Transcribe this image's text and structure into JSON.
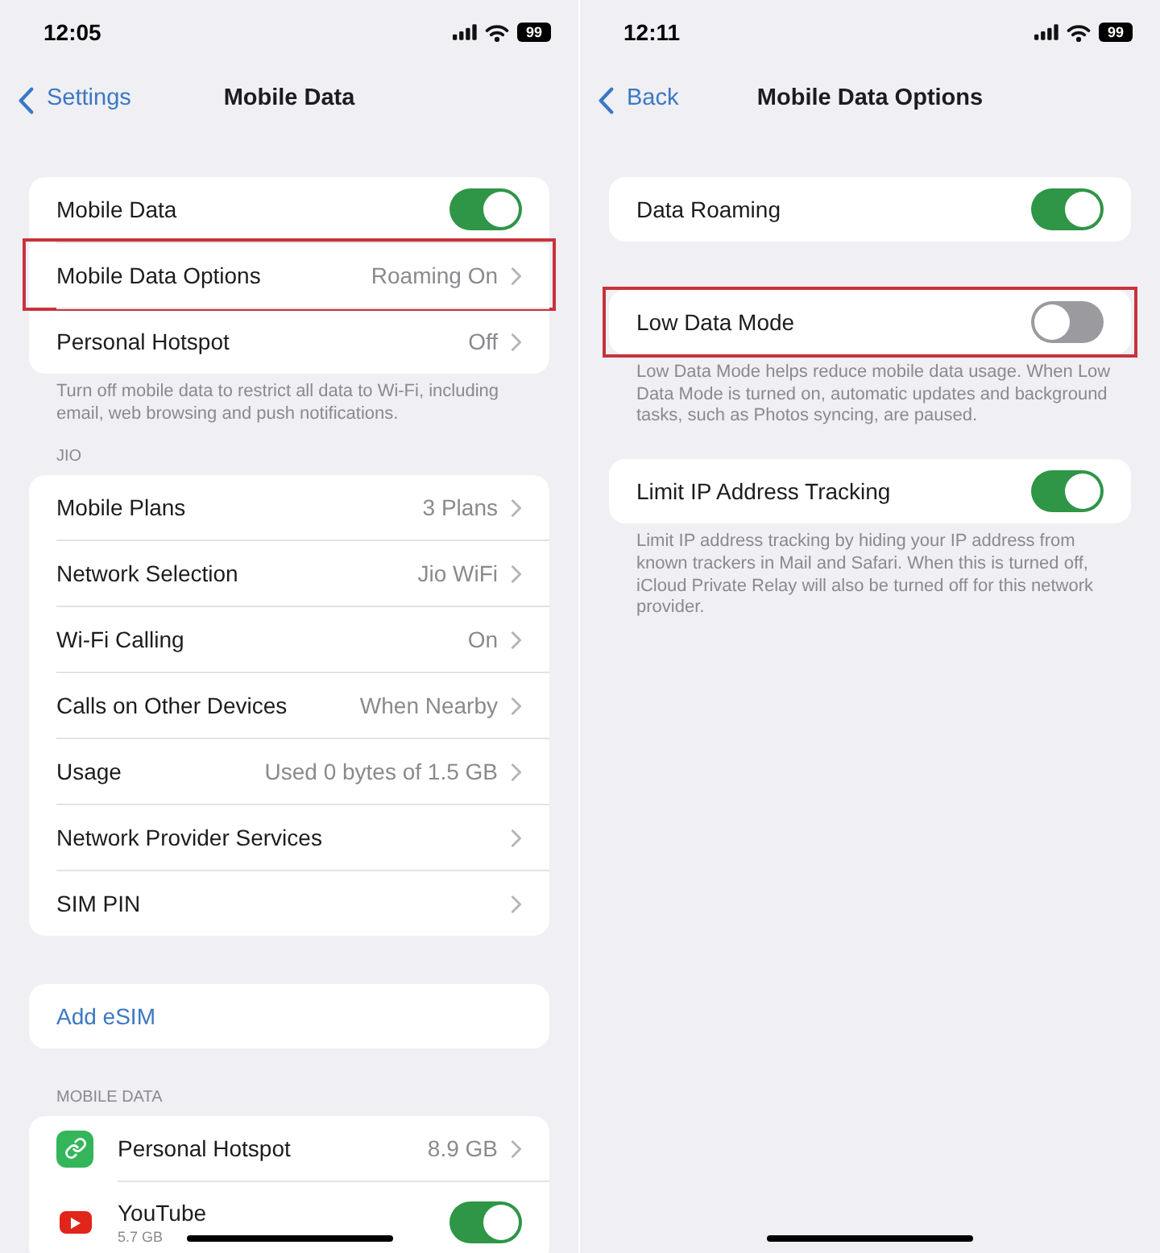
{
  "screens": [
    {
      "status_bar": {
        "time": "12:05",
        "battery": "99"
      },
      "nav": {
        "back": "Settings",
        "title": "Mobile Data"
      },
      "sections": [
        {
          "rows": [
            {
              "kind": "toggle",
              "label": "Mobile Data",
              "on": true,
              "highlighted": false
            },
            {
              "kind": "link",
              "label": "Mobile Data Options",
              "value": "Roaming On",
              "highlighted": true
            },
            {
              "kind": "link",
              "label": "Personal Hotspot",
              "value": "Off",
              "highlighted": false
            }
          ],
          "footer": "Turn off mobile data to restrict all data to Wi-Fi, including email, web browsing and push notifications."
        },
        {
          "header": "JIO",
          "rows": [
            {
              "kind": "link",
              "label": "Mobile Plans",
              "value": "3 Plans",
              "highlighted": false
            },
            {
              "kind": "link",
              "label": "Network Selection",
              "value": "Jio WiFi",
              "highlighted": false
            },
            {
              "kind": "link",
              "label": "Wi-Fi Calling",
              "value": "On",
              "highlighted": false
            },
            {
              "kind": "link",
              "label": "Calls on Other Devices",
              "value": "When Nearby",
              "highlighted": false
            },
            {
              "kind": "link",
              "label": "Usage",
              "value": "Used 0 bytes of 1.5 GB",
              "highlighted": false
            },
            {
              "kind": "link",
              "label": "Network Provider Services",
              "highlighted": false
            },
            {
              "kind": "link",
              "label": "SIM PIN",
              "highlighted": false
            }
          ]
        },
        {
          "rows": [
            {
              "kind": "action",
              "label": "Add eSIM",
              "highlighted": false
            }
          ]
        },
        {
          "header": "MOBILE DATA",
          "rows": [
            {
              "kind": "app_link",
              "label": "Personal Hotspot",
              "value": "8.9 GB",
              "color": "#34b55a",
              "highlighted": false
            },
            {
              "kind": "app_toggle",
              "label": "YouTube",
              "detail": "5.7 GB",
              "on": true,
              "color": "#e1251b",
              "highlighted": false
            }
          ]
        }
      ]
    },
    {
      "status_bar": {
        "time": "12:11",
        "battery": "99"
      },
      "nav": {
        "back": "Back",
        "title": "Mobile Data Options"
      },
      "sections": [
        {
          "rows": [
            {
              "kind": "toggle",
              "label": "Data Roaming",
              "on": true,
              "highlighted": false
            }
          ]
        },
        {
          "rows": [
            {
              "kind": "toggle",
              "label": "Low Data Mode",
              "on": false,
              "highlighted": true
            }
          ],
          "footer": "Low Data Mode helps reduce mobile data usage. When Low Data Mode is turned on, automatic updates and background tasks, such as Photos syncing, are paused."
        },
        {
          "rows": [
            {
              "kind": "toggle",
              "label": "Limit IP Address Tracking",
              "on": true,
              "highlighted": false
            }
          ],
          "footer": "Limit IP address tracking by hiding your IP address from known trackers in Mail and Safari. When this is turned off, iCloud Private Relay will also be turned off for this network provider."
        }
      ]
    }
  ]
}
